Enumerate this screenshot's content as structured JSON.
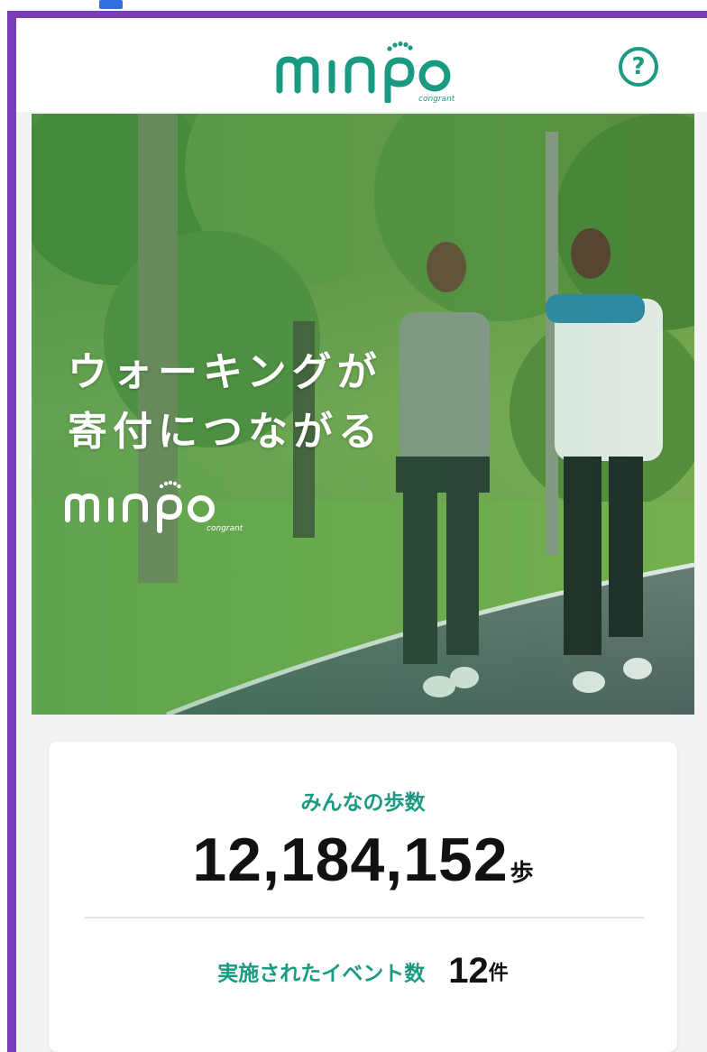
{
  "app": {
    "logo_text": "minpo",
    "logo_subtext": "congrant",
    "help_label": "?"
  },
  "hero": {
    "line1": "ウォーキングが",
    "line2": "寄付につながる",
    "logo_text": "minpo",
    "logo_subtext": "congrant"
  },
  "stats": {
    "steps_label": "みんなの歩数",
    "steps_value": "12,184,152",
    "steps_unit": "歩",
    "events_label": "実施されたイベント数",
    "events_value": "12",
    "events_unit": "件"
  },
  "colors": {
    "brand": "#1a9a80",
    "frame": "#7a3db8",
    "text_dark": "#111111"
  },
  "icons": {
    "help": "question-circle-icon",
    "logo_feet": "footprint-dots-icon"
  }
}
